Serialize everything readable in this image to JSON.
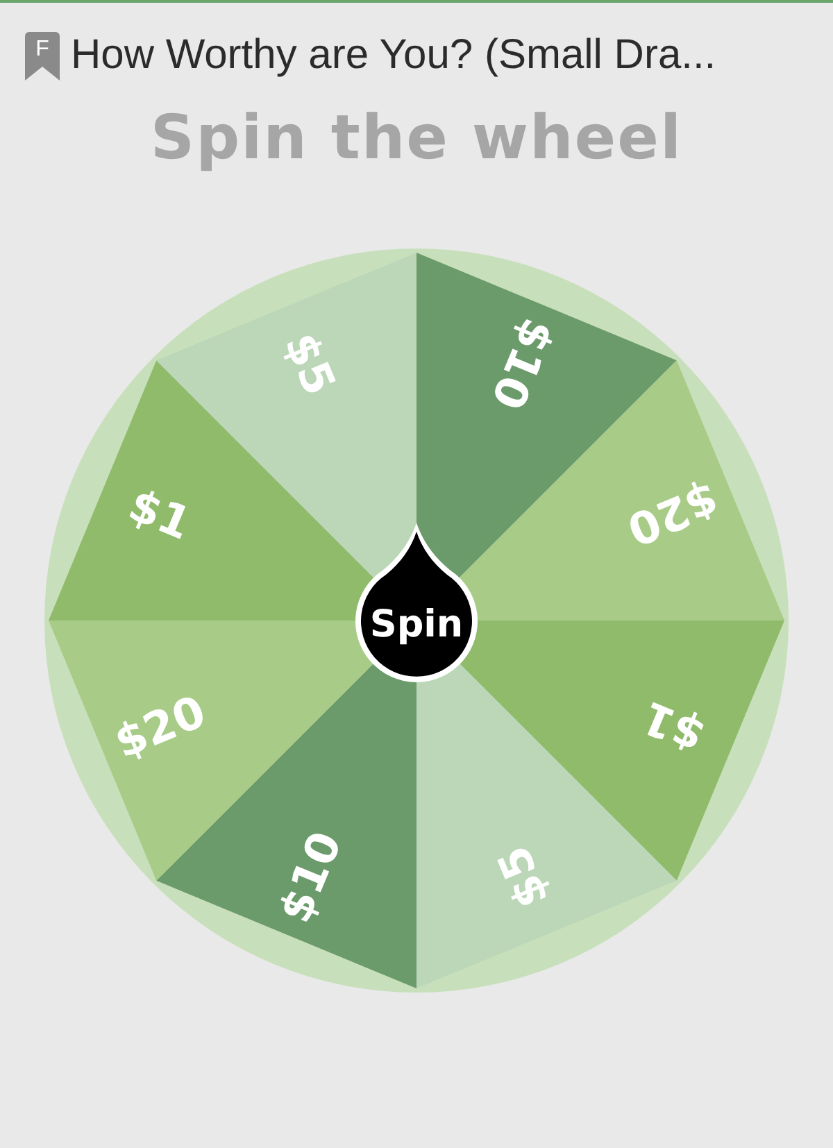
{
  "header": {
    "badge": "F",
    "title": "How Worthy are You? (Small Dra..."
  },
  "heading": "Spin the wheel",
  "wheel": {
    "segments": [
      {
        "label": "$10",
        "color": "#6b9a6b"
      },
      {
        "label": "$20",
        "color": "#a8cc88"
      },
      {
        "label": "$1",
        "color": "#8fbb6b"
      },
      {
        "label": "$5",
        "color": "#bcd7b8"
      },
      {
        "label": "$10",
        "color": "#6b9a6b"
      },
      {
        "label": "$20",
        "color": "#a8cc88"
      },
      {
        "label": "$1",
        "color": "#8fbb6b"
      },
      {
        "label": "$5",
        "color": "#bcd7b8"
      }
    ],
    "spin_button": "Spin"
  }
}
